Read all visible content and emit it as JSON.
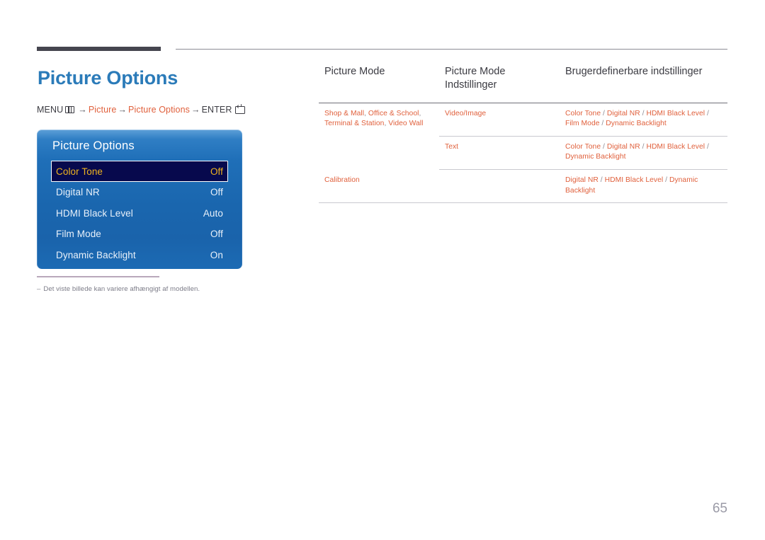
{
  "page": {
    "title": "Picture Options",
    "page_number": "65"
  },
  "breadcrumb": {
    "menu_label": "MENU",
    "menu_icon": "menu-grid-icon",
    "arrow": "→",
    "step1": "Picture",
    "step2": "Picture Options",
    "enter_label": "ENTER",
    "enter_icon": "enter-key-icon"
  },
  "osd": {
    "title": "Picture Options",
    "rows": [
      {
        "label": "Color Tone",
        "value": "Off",
        "selected": true
      },
      {
        "label": "Digital NR",
        "value": "Off",
        "selected": false
      },
      {
        "label": "HDMI Black Level",
        "value": "Auto",
        "selected": false
      },
      {
        "label": "Film Mode",
        "value": "Off",
        "selected": false
      },
      {
        "label": "Dynamic Backlight",
        "value": "On",
        "selected": false
      }
    ]
  },
  "footnote": {
    "dash": "–",
    "text": "Det viste billede kan variere afhængigt af modellen."
  },
  "table": {
    "headers": {
      "col1": "Picture Mode",
      "col2": "Picture Mode Indstillinger",
      "col3": "Brugerdefinerbare indstillinger"
    },
    "rows": [
      {
        "picture_mode": "Shop & Mall, Office & School, Terminal & Station, Video Wall",
        "mode_settings": "Video/Image",
        "customizable": "Color Tone / Digital NR / HDMI Black Level / Film Mode / Dynamic Backlight"
      },
      {
        "picture_mode": "",
        "mode_settings": "Text",
        "customizable": "Color Tone / Digital NR / HDMI Black Level / Dynamic Backlight"
      },
      {
        "picture_mode": "Calibration",
        "mode_settings": "",
        "customizable": "Digital NR / HDMI Black Level / Dynamic Backlight"
      }
    ]
  },
  "colors": {
    "accent_blue": "#2b7bb9",
    "accent_orange": "#e0603c",
    "osd_blue": "#1a66ae",
    "osd_selected_bg": "#07094d",
    "osd_selected_text": "#efb41f",
    "rule_dark": "#45454f",
    "note_rule": "#b9a8bb"
  }
}
